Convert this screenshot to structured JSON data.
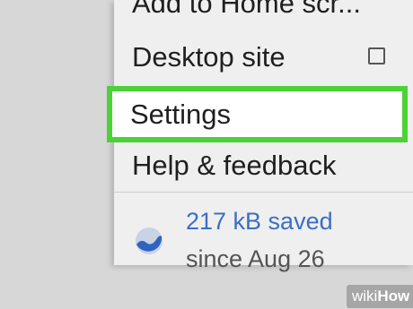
{
  "menu": {
    "items": [
      {
        "label": "Add to Home scr..."
      },
      {
        "label": "Desktop site"
      },
      {
        "label": "Settings"
      },
      {
        "label": "Help & feedback"
      }
    ],
    "desktop_site_checked": false,
    "data_saver": {
      "icon": "data-saver-icon",
      "saved_text": "217 kB saved",
      "since_text": "since Aug 26"
    }
  },
  "watermark": {
    "wiki": "wiki",
    "how": "How"
  },
  "colors": {
    "highlight": "#4cd137",
    "link_blue": "#3a6fc4",
    "menu_bg": "#efefef",
    "page_bg": "#d7d7d7"
  }
}
